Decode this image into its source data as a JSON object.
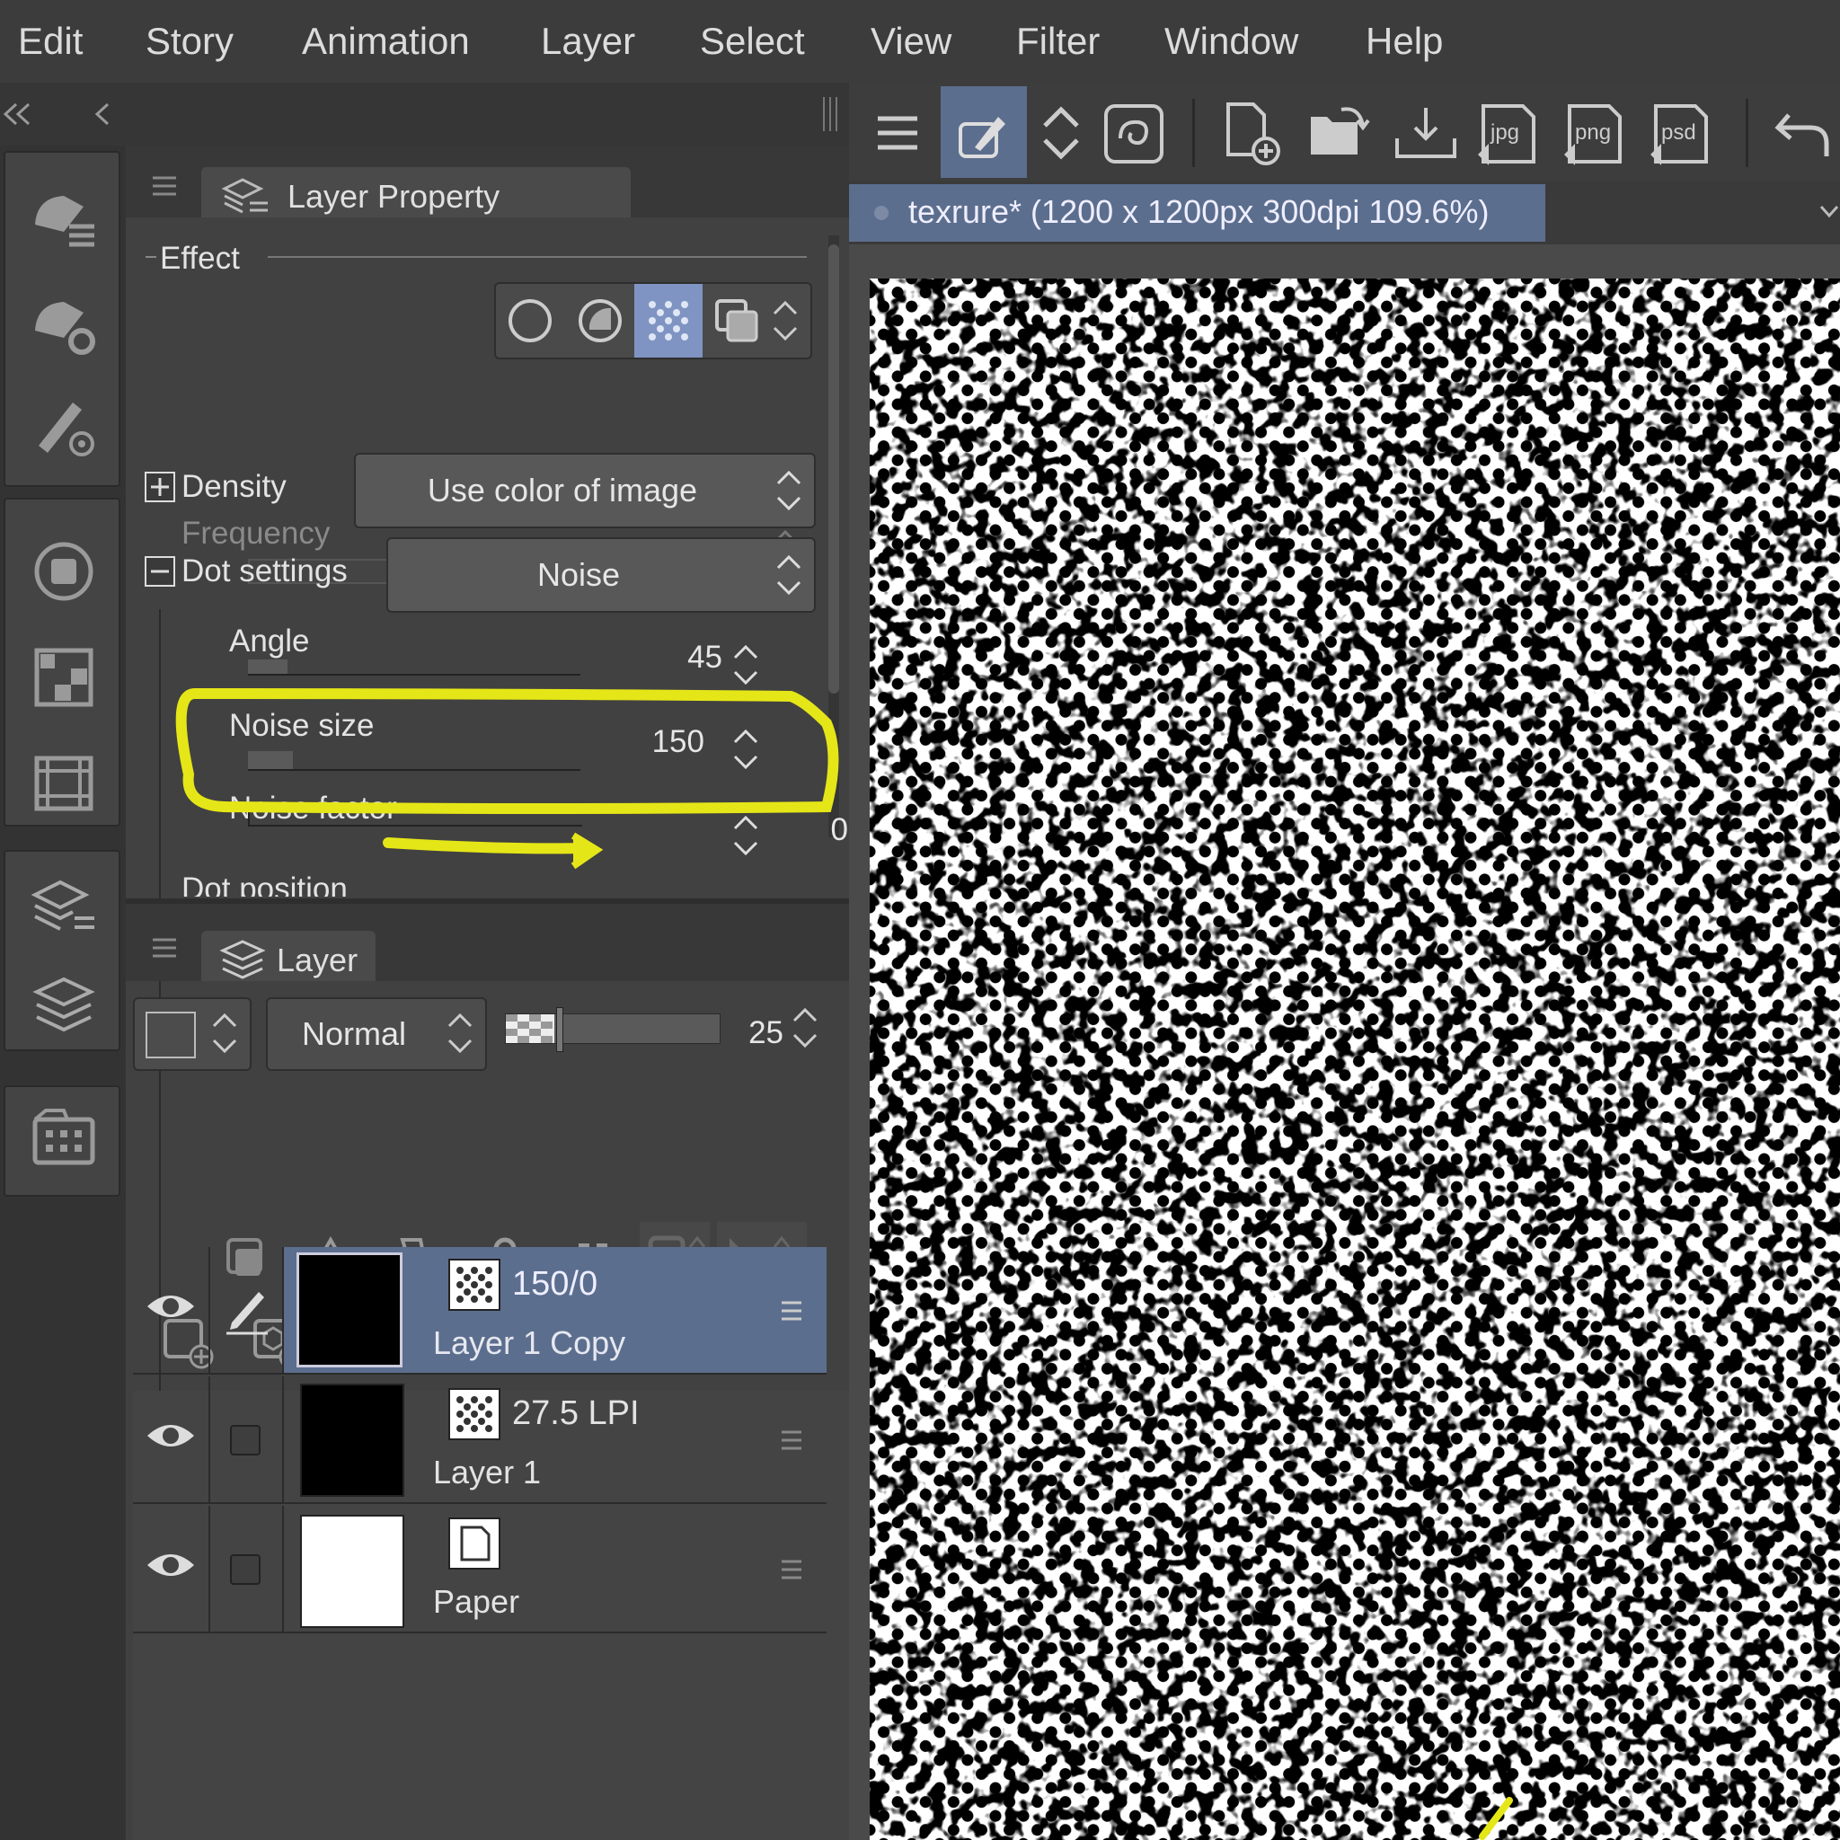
{
  "menu": [
    "Edit",
    "Story",
    "Animation",
    "Layer",
    "Select",
    "View",
    "Filter",
    "Window",
    "Help"
  ],
  "property_panel": {
    "tab_label": "Layer Property",
    "effect_label": "Effect",
    "frequency_label": "Frequency",
    "density_label": "Density",
    "density_value": "Use color of image",
    "dot_settings_label": "Dot settings",
    "dot_settings_value": "Noise",
    "angle_label": "Angle",
    "angle_value": "45",
    "noise_size_label": "Noise size",
    "noise_size_value": "150",
    "noise_factor_label": "Noise factor",
    "noise_factor_value": "0",
    "dot_position_label": "Dot position"
  },
  "layer_panel": {
    "tab_label": "Layer",
    "blend_mode": "Normal",
    "opacity_value": "25",
    "layers": [
      {
        "info": "150/0",
        "name": "Layer 1 Copy",
        "selected": true
      },
      {
        "info": "27.5 LPI",
        "name": "Layer 1",
        "selected": false
      },
      {
        "info": "",
        "name": "Paper",
        "selected": false
      }
    ]
  },
  "document": {
    "tab_title": "texrure* (1200 x 1200px 300dpi 109.6%)"
  },
  "toolbar_icons": [
    "menu-icon",
    "eyedropper-tool-icon",
    "updown-icon",
    "swirl-icon",
    "new-canvas-icon",
    "open-folder-icon",
    "import-icon",
    "export-jpg-icon",
    "export-png-icon",
    "export-psd-icon",
    "undo-icon"
  ],
  "toolbar_labels": {
    "jpg": "jpg",
    "png": "png",
    "psd": "psd"
  },
  "colors": {
    "accent": "#5c6e8e",
    "highlight": "#e5e617",
    "panel": "#414141"
  }
}
